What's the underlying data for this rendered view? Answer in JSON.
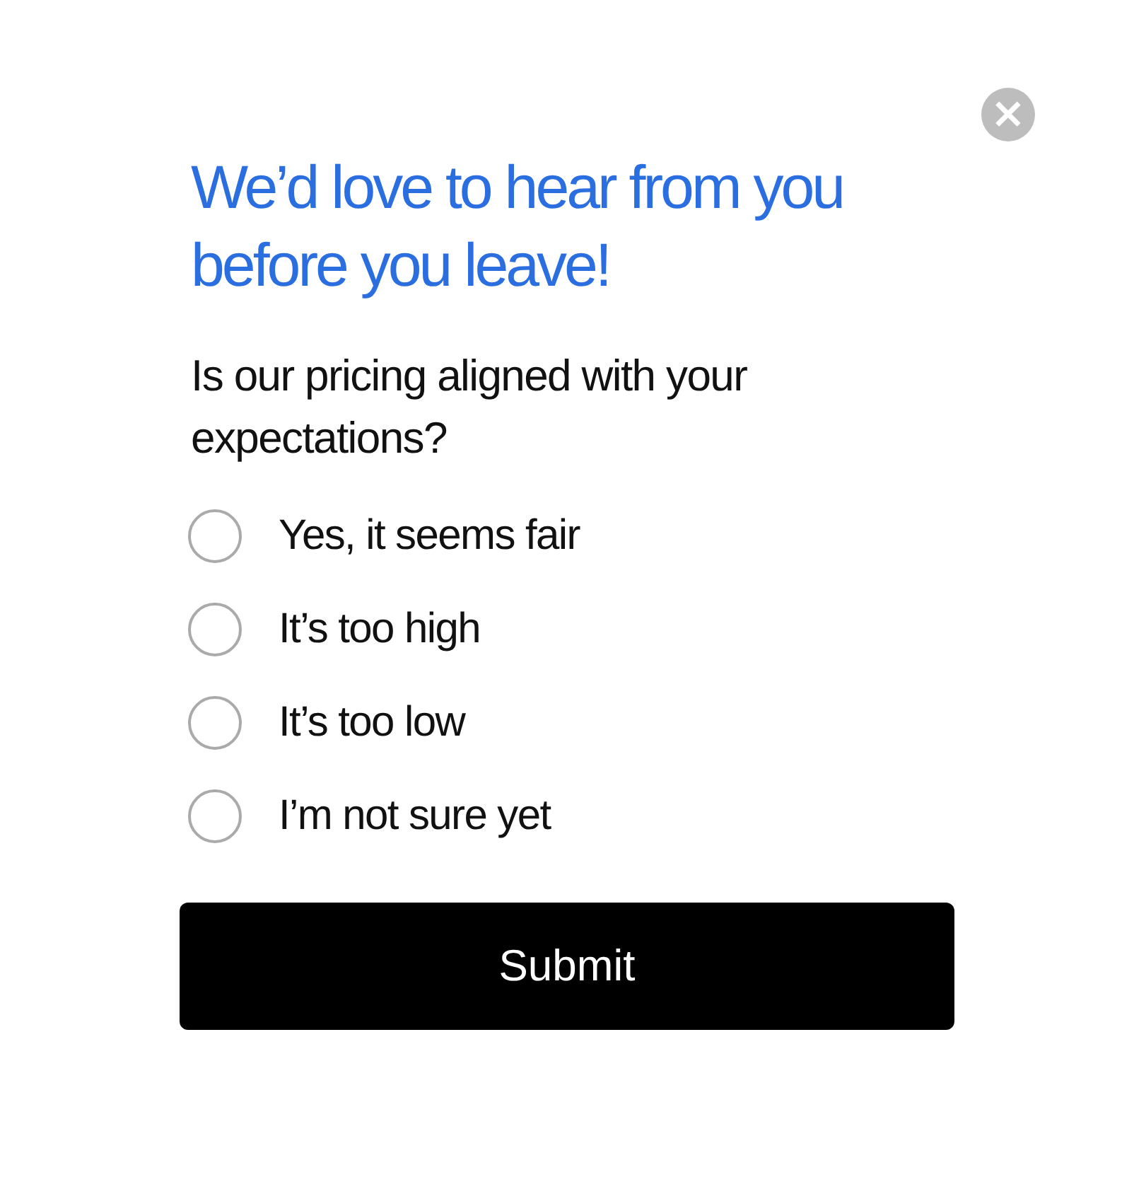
{
  "close_button": {
    "label": "×"
  },
  "title": "We’d love to hear from you before you leave!",
  "question": "Is our pricing aligned with your expectations?",
  "options": [
    {
      "label": "Yes, it seems fair",
      "selected": false
    },
    {
      "label": "It’s too high",
      "selected": false
    },
    {
      "label": "It’s too low",
      "selected": false
    },
    {
      "label": "I’m not sure yet",
      "selected": false
    }
  ],
  "submit_button": {
    "label": "Submit"
  }
}
